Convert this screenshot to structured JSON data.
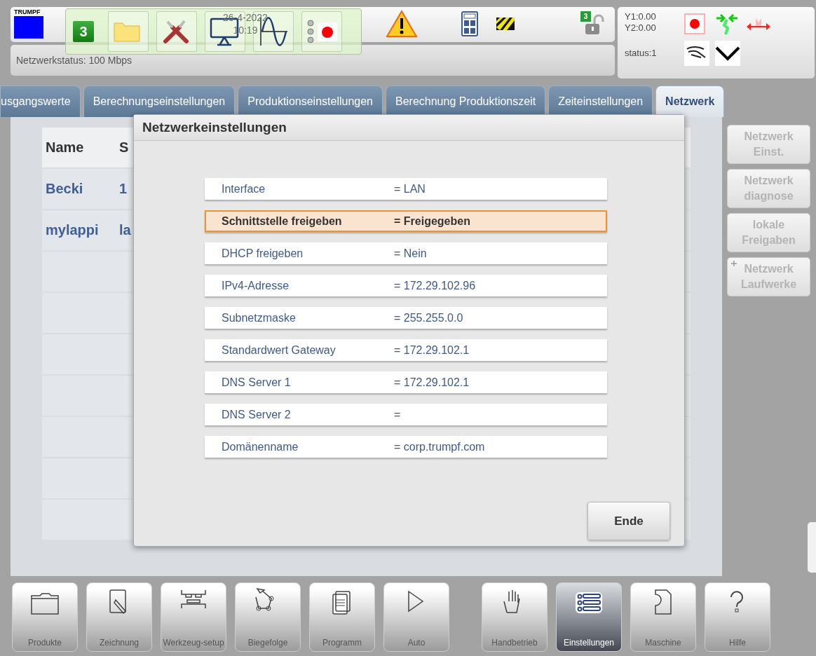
{
  "header": {
    "logo": "TRUMPF",
    "date": "26-4-2022",
    "time": "10:19",
    "network_status": "Netzwerkstatus: 100 Mbps",
    "quick_badge": "3",
    "lock_badge": "3"
  },
  "axes": {
    "y1": "Y1:0.00",
    "y2": "Y2:0.00",
    "status": "status:1"
  },
  "tabs": [
    {
      "label": "usgangswerte",
      "selected": false
    },
    {
      "label": "Berechnungseinstellungen",
      "selected": false
    },
    {
      "label": "Produktionseinstellungen",
      "selected": false
    },
    {
      "label": "Berechnung Produktionszeit",
      "selected": false
    },
    {
      "label": "Zeiteinstellungen",
      "selected": false
    },
    {
      "label": "Netzwerk",
      "selected": true
    }
  ],
  "table": {
    "columns": [
      "Name",
      "S"
    ],
    "rows": [
      [
        "Becki",
        "1"
      ],
      [
        "mylappi",
        "la"
      ]
    ]
  },
  "side_buttons": [
    {
      "label": "Netzwerk Einst.",
      "disabled": true,
      "plus": false
    },
    {
      "label": "Netzwerk diagnose",
      "disabled": true,
      "plus": false
    },
    {
      "label": "lokale Freigaben",
      "disabled": true,
      "plus": false
    },
    {
      "label": "Netzwerk Laufwerke",
      "disabled": true,
      "plus": true
    }
  ],
  "dialog": {
    "title": "Netzwerkeinstellungen",
    "fields": [
      {
        "label": "Interface",
        "value": "= LAN",
        "selected": false
      },
      {
        "label": "Schnittstelle freigeben",
        "value": "= Freigegeben",
        "selected": true
      },
      {
        "label": "DHCP freigeben",
        "value": "= Nein",
        "selected": false
      },
      {
        "label": "IPv4-Adresse",
        "value": "= 172.29.102.96",
        "selected": false
      },
      {
        "label": "Subnetzmaske",
        "value": "= 255.255.0.0",
        "selected": false
      },
      {
        "label": "Standardwert Gateway",
        "value": "= 172.29.102.1",
        "selected": false
      },
      {
        "label": "DNS Server 1",
        "value": "= 172.29.102.1",
        "selected": false
      },
      {
        "label": "DNS Server 2",
        "value": "=",
        "selected": false
      },
      {
        "label": "Domänenname",
        "value": "= corp.trumpf.com",
        "selected": false
      }
    ],
    "button": "Ende"
  },
  "toolbar": [
    {
      "label": "Produkte",
      "kind": "folder",
      "selected": false
    },
    {
      "label": "Zeichnung",
      "kind": "drawing",
      "selected": false
    },
    {
      "label": "Werkzeug-setup",
      "kind": "tools",
      "selected": false
    },
    {
      "label": "Biegefolge",
      "kind": "sequence",
      "selected": false
    },
    {
      "label": "Programm",
      "kind": "program",
      "selected": false
    },
    {
      "label": "Auto",
      "kind": "play",
      "selected": false
    },
    {
      "label": "Handbetrieb",
      "kind": "hand",
      "selected": false
    },
    {
      "label": "Einstellungen",
      "kind": "list",
      "selected": true
    },
    {
      "label": "Maschine",
      "kind": "machine",
      "selected": false
    },
    {
      "label": "Hilfe",
      "kind": "help",
      "selected": false
    }
  ]
}
